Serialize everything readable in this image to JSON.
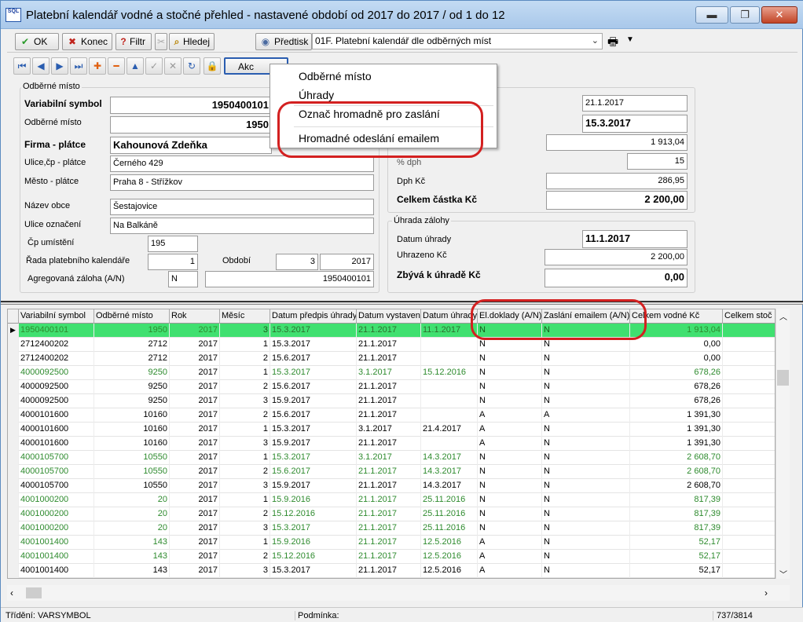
{
  "window": {
    "title": "Platební kalendář vodné a stočné přehled - nastavené období od 2017 do 2017 / od 1 do 12",
    "logo": "SQL",
    "minimize": "▬",
    "maximize": "❐",
    "close": "✕"
  },
  "toolbar": {
    "ok": "OK",
    "konec": "Konec",
    "filtr": "Filtr",
    "hledej": "Hledej",
    "predtisk": "Předtisk",
    "report_select": "01F. Platební kalendář dle odběrných míst"
  },
  "nav": {
    "akce_label": "Akc"
  },
  "menu": {
    "items": [
      "Odběrné místo",
      "Úhrady",
      "Označ hromadně pro zaslání",
      "Hromadné odeslání emailem"
    ]
  },
  "form": {
    "group_title": "Odběrné místo",
    "variabilni_symbol_label": "Variabilní symbol",
    "variabilni_symbol": "1950400101",
    "odberne_misto_label": "Odběrné místo",
    "odberne_misto": "1950",
    "firma_label": "Firma - plátce",
    "firma": "Kahounová Zdeňka",
    "ulice_label": "Ulice,čp - plátce",
    "ulice": "Černého 429",
    "mesto_label": "Město - plátce",
    "mesto": "Praha 8 - Střížkov",
    "nazev_obce_label": "Název obce",
    "nazev_obce": "Šestajovice",
    "ulice_ozn_label": "Ulice označení",
    "ulice_ozn": "Na Balkáně",
    "cp_label": "Čp umístění",
    "cp": "195",
    "rada_label": "Řada platebního kalendáře",
    "rada": "1",
    "obdobi_label": "Období",
    "obdobi_mesic": "3",
    "obdobi_rok": "2017",
    "agregovana_label": "Agregovaná záloha (A/N)",
    "agregovana": "N",
    "agregovana_vs": "1950400101"
  },
  "right": {
    "datum1": "21.1.2017",
    "datum2": "15.3.2017",
    "castka": "1 913,04",
    "dph_pct_label": "% dph",
    "dph_pct": "15",
    "dph_label": "Dph Kč",
    "dph": "286,95",
    "celkem_label": "Celkem částka Kč",
    "celkem": "2 200,00",
    "uhrada_title": "Úhrada zálohy",
    "datum_uhrady_label": "Datum úhrady",
    "datum_uhrady": "11.1.2017",
    "uhrazeno_label": "Uhrazeno Kč",
    "uhrazeno": "2 200,00",
    "zbyva_label": "Zbývá k úhradě Kč",
    "zbyva": "0,00"
  },
  "grid": {
    "columns": [
      "Variabilní symbol",
      "Odběrné místo",
      "Rok",
      "Měsíc",
      "Datum předpis úhrady",
      "Datum vystavení",
      "Datum úhrady",
      "El.doklady (A/N)",
      "Zaslání emailem (A/N)",
      "Celkem vodné Kč",
      "Celkem stoč"
    ],
    "colors": {
      "green": "#2e8b2e",
      "black": "#000000",
      "selected_bg": "#40e070"
    },
    "rows": [
      [
        "1950400101",
        "1950",
        "2017",
        "3",
        "15.3.2017",
        "21.1.2017",
        "11.1.2017",
        "N",
        "N",
        "1 913,04",
        "sel"
      ],
      [
        "2712400202",
        "2712",
        "2017",
        "1",
        "15.3.2017",
        "21.1.2017",
        "",
        "N",
        "N",
        "0,00",
        "black"
      ],
      [
        "2712400202",
        "2712",
        "2017",
        "2",
        "15.6.2017",
        "21.1.2017",
        "",
        "N",
        "N",
        "0,00",
        "black"
      ],
      [
        "4000092500",
        "9250",
        "2017",
        "1",
        "15.3.2017",
        "3.1.2017",
        "15.12.2016",
        "N",
        "N",
        "678,26",
        "green"
      ],
      [
        "4000092500",
        "9250",
        "2017",
        "2",
        "15.6.2017",
        "21.1.2017",
        "",
        "N",
        "N",
        "678,26",
        "black"
      ],
      [
        "4000092500",
        "9250",
        "2017",
        "3",
        "15.9.2017",
        "21.1.2017",
        "",
        "N",
        "N",
        "678,26",
        "black"
      ],
      [
        "4000101600",
        "10160",
        "2017",
        "2",
        "15.6.2017",
        "21.1.2017",
        "",
        "A",
        "A",
        "1 391,30",
        "black"
      ],
      [
        "4000101600",
        "10160",
        "2017",
        "1",
        "15.3.2017",
        "3.1.2017",
        "21.4.2017",
        "A",
        "N",
        "1 391,30",
        "black"
      ],
      [
        "4000101600",
        "10160",
        "2017",
        "3",
        "15.9.2017",
        "21.1.2017",
        "",
        "A",
        "N",
        "1 391,30",
        "black"
      ],
      [
        "4000105700",
        "10550",
        "2017",
        "1",
        "15.3.2017",
        "3.1.2017",
        "14.3.2017",
        "N",
        "N",
        "2 608,70",
        "green"
      ],
      [
        "4000105700",
        "10550",
        "2017",
        "2",
        "15.6.2017",
        "21.1.2017",
        "14.3.2017",
        "N",
        "N",
        "2 608,70",
        "green"
      ],
      [
        "4000105700",
        "10550",
        "2017",
        "3",
        "15.9.2017",
        "21.1.2017",
        "14.3.2017",
        "N",
        "N",
        "2 608,70",
        "black"
      ],
      [
        "4001000200",
        "20",
        "2017",
        "1",
        "15.9.2016",
        "21.1.2017",
        "25.11.2016",
        "N",
        "N",
        "817,39",
        "green"
      ],
      [
        "4001000200",
        "20",
        "2017",
        "2",
        "15.12.2016",
        "21.1.2017",
        "25.11.2016",
        "N",
        "N",
        "817,39",
        "green"
      ],
      [
        "4001000200",
        "20",
        "2017",
        "3",
        "15.3.2017",
        "21.1.2017",
        "25.11.2016",
        "N",
        "N",
        "817,39",
        "green"
      ],
      [
        "4001001400",
        "143",
        "2017",
        "1",
        "15.9.2016",
        "21.1.2017",
        "12.5.2016",
        "A",
        "N",
        "52,17",
        "green"
      ],
      [
        "4001001400",
        "143",
        "2017",
        "2",
        "15.12.2016",
        "21.1.2017",
        "12.5.2016",
        "A",
        "N",
        "52,17",
        "green"
      ],
      [
        "4001001400",
        "143",
        "2017",
        "3",
        "15.3.2017",
        "21.1.2017",
        "12.5.2016",
        "A",
        "N",
        "52,17",
        "black"
      ]
    ]
  },
  "status": {
    "trideni": "Třídění: VARSYMBOL",
    "podminka": "Podmínka:",
    "pocet": "737/3814"
  }
}
